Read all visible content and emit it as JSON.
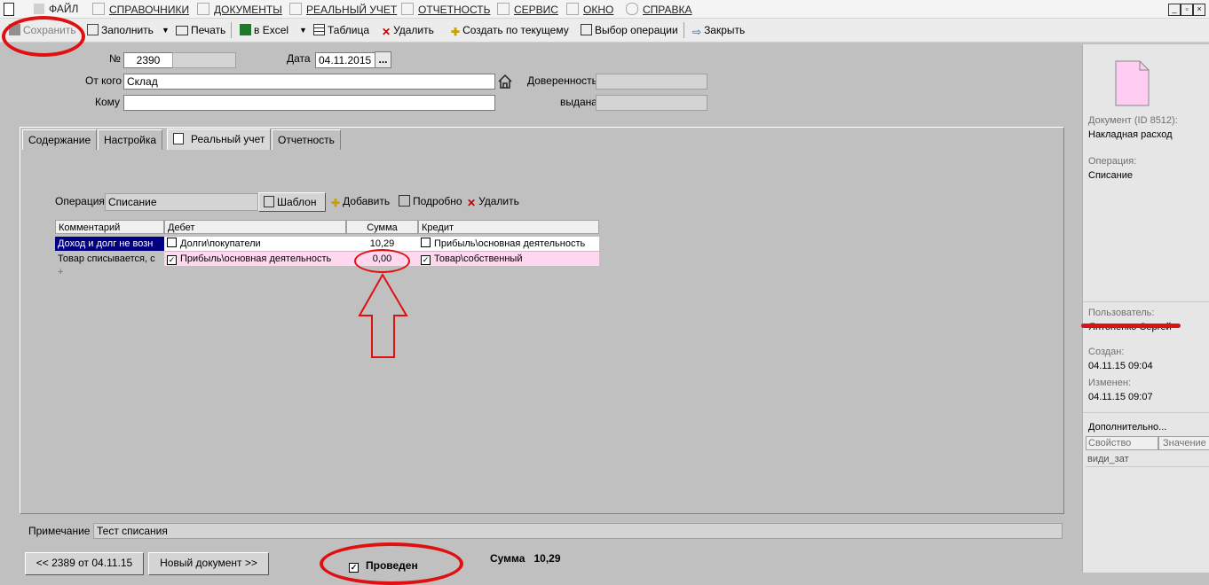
{
  "menu": {
    "items": [
      "ФАЙЛ",
      "СПРАВОЧНИКИ",
      "ДОКУМЕНТЫ",
      "РЕАЛЬНЫЙ УЧЕТ",
      "ОТЧЕТНОСТЬ",
      "СЕРВИС",
      "ОКНО",
      "СПРАВКА"
    ],
    "window_controls": [
      "_",
      "▫",
      "×"
    ]
  },
  "toolbar": {
    "save": "Сохранить",
    "fill": "Заполнить",
    "print": "Печать",
    "excel": "в Excel",
    "table": "Таблица",
    "delete": "Удалить",
    "create_by_current": "Создать по текущему",
    "choose_operation": "Выбор операции",
    "close": "Закрыть"
  },
  "header": {
    "number_label": "№",
    "number_value": "2390",
    "date_label": "Дата",
    "date_value": "04.11.2015",
    "date_button": "...",
    "from_label": "От кого",
    "from_value": "Склад",
    "to_label": "Кому",
    "to_value": "",
    "power_label": "Доверенность",
    "power_value": "",
    "issued_label": "выдана",
    "issued_value": ""
  },
  "tabs": [
    "Содержание",
    "Настройка",
    "Реальный учет",
    "Отчетность"
  ],
  "operation": {
    "label": "Операция",
    "value": "Списание",
    "template": "Шаблон",
    "add": "Добавить",
    "details": "Подробно",
    "delete": "Удалить"
  },
  "grid": {
    "columns": [
      "Комментарий",
      "Дебет",
      "Сумма",
      "Кредит"
    ],
    "rows": [
      {
        "comment": "Доход и долг не возн",
        "debit": "Долги\\покупатели",
        "debit_checked": false,
        "sum": "10,29",
        "credit": "Прибыль\\основная деятельность",
        "credit_checked": false
      },
      {
        "comment": "Товар списывается, с",
        "debit": "Прибыль\\основная деятельность",
        "debit_checked": true,
        "sum": "0,00",
        "credit": "Товар\\собственный",
        "credit_checked": true
      }
    ],
    "add_row": "+"
  },
  "note": {
    "label": "Примечание",
    "value": "Тест списания"
  },
  "footer": {
    "prev": "<< 2389 от 04.11.15",
    "next": "Новый документ >>",
    "posted": "Проведен",
    "posted_checked": true,
    "sum_label": "Сумма",
    "sum_value": "10,29"
  },
  "info": {
    "doc_label": "Документ  (ID 8512):",
    "doc_value": "Накладная расход",
    "op_label": "Операция:",
    "op_value": "Списание",
    "user_label": "Пользователь:",
    "user_value": "Янтоненко Сергей",
    "created_label": "Создан:",
    "created_value": "04.11.15  09:04",
    "changed_label": "Изменен:",
    "changed_value": "04.11.15  09:07",
    "more_label": "Дополнительно...",
    "prop_header": "Свойство",
    "value_header": "Значение",
    "prop_row": "види_зат"
  },
  "colors": {
    "annotation_red": "#e01010",
    "selected_row": "#000080",
    "pink_row": "#ffd8f0",
    "doc_icon": "#ffccf2"
  }
}
